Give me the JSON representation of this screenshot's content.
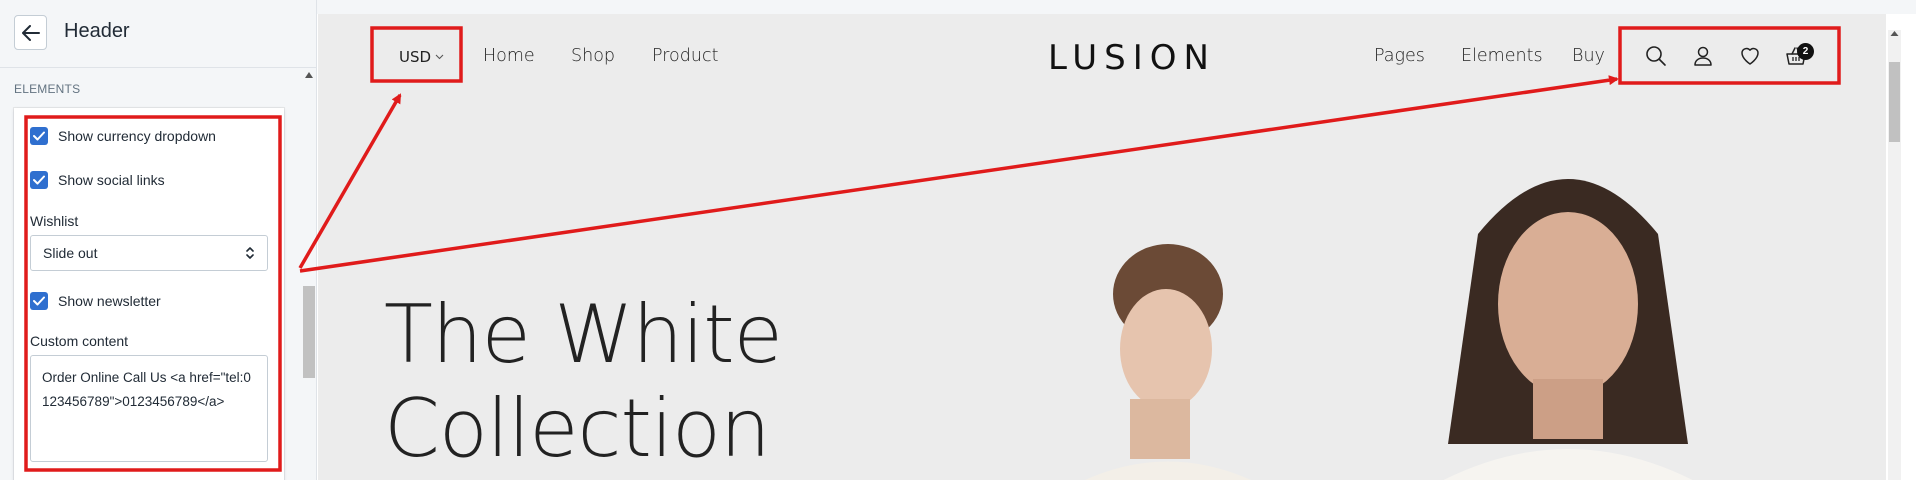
{
  "sidebar": {
    "title": "Header",
    "section_label": "ELEMENTS",
    "options": {
      "show_currency_label": "Show currency dropdown",
      "show_social_label": "Show social links",
      "wishlist_label": "Wishlist",
      "wishlist_value": "Slide out",
      "show_newsletter_label": "Show newsletter",
      "custom_content_label": "Custom content",
      "custom_content_value": "Order Online Call Us <a href=\"tel:0123456789\">0123456789</a>"
    },
    "checked": {
      "currency": true,
      "social": true,
      "newsletter": true
    }
  },
  "store": {
    "currency": "USD",
    "nav_left": [
      "Home",
      "Shop",
      "Product"
    ],
    "logo": "LUSION",
    "nav_right": [
      "Pages",
      "Elements",
      "Buy"
    ],
    "cart_count": "2",
    "hero_line1": "The White",
    "hero_line2": "Collection"
  },
  "colors": {
    "accent_checkbox": "#2f6fcf",
    "annotation_red": "#e01b1b"
  },
  "icons": {
    "back": "arrow-left-icon",
    "search": "search-icon",
    "account": "user-icon",
    "wishlist": "heart-icon",
    "cart": "basket-icon"
  }
}
